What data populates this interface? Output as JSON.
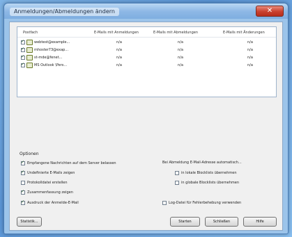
{
  "window": {
    "title": "Anmeldungen/Abmeldungen ändern",
    "close_glyph": "✕"
  },
  "list": {
    "columns": [
      "Postfach",
      "E-Mails mit Anmeldungen",
      "E-Mails mit Abmeldungen",
      "E-Mails mit Änderungen"
    ],
    "rows": [
      {
        "checked": true,
        "account": "webtest@example...",
        "c1": "n/a",
        "c2": "n/a",
        "c3": "n/a"
      },
      {
        "checked": true,
        "account": "mhoster73@exap...",
        "c1": "n/a",
        "c2": "n/a",
        "c3": "n/a"
      },
      {
        "checked": true,
        "account": "st-mde@fenet...",
        "c1": "n/a",
        "c2": "n/a",
        "c3": "n/a"
      },
      {
        "checked": true,
        "account": "MS Outlook \\Pers...",
        "c1": "n/a",
        "c2": "n/a",
        "c3": "n/a"
      }
    ]
  },
  "options": {
    "label": "Optionen",
    "left": [
      {
        "checked": true,
        "text": "Empfangene Nachrichten auf dem Server belassen"
      },
      {
        "checked": true,
        "text": "Undefinierte E-Mails zeigen"
      },
      {
        "checked": false,
        "text": "Protokolldatei erstellen"
      },
      {
        "checked": true,
        "text": "Zusammenfassung zeigen"
      },
      {
        "checked": true,
        "text": "Ausdruck der Anmelde-E-Mail"
      }
    ],
    "right_label": "Bei Abmeldung E-Mail-Adresse automatisch...",
    "right": [
      {
        "checked": false,
        "text": "in lokale Blocklists übernehmen"
      },
      {
        "checked": false,
        "text": "in globale Blocklists übernehmen"
      },
      {
        "checked": false,
        "text": "Log-Datei für Fehlerbehebung verwenden"
      }
    ]
  },
  "buttons": {
    "stats": "Statistik...",
    "start": "Starten",
    "close": "Schließen",
    "help": "Hilfe"
  }
}
